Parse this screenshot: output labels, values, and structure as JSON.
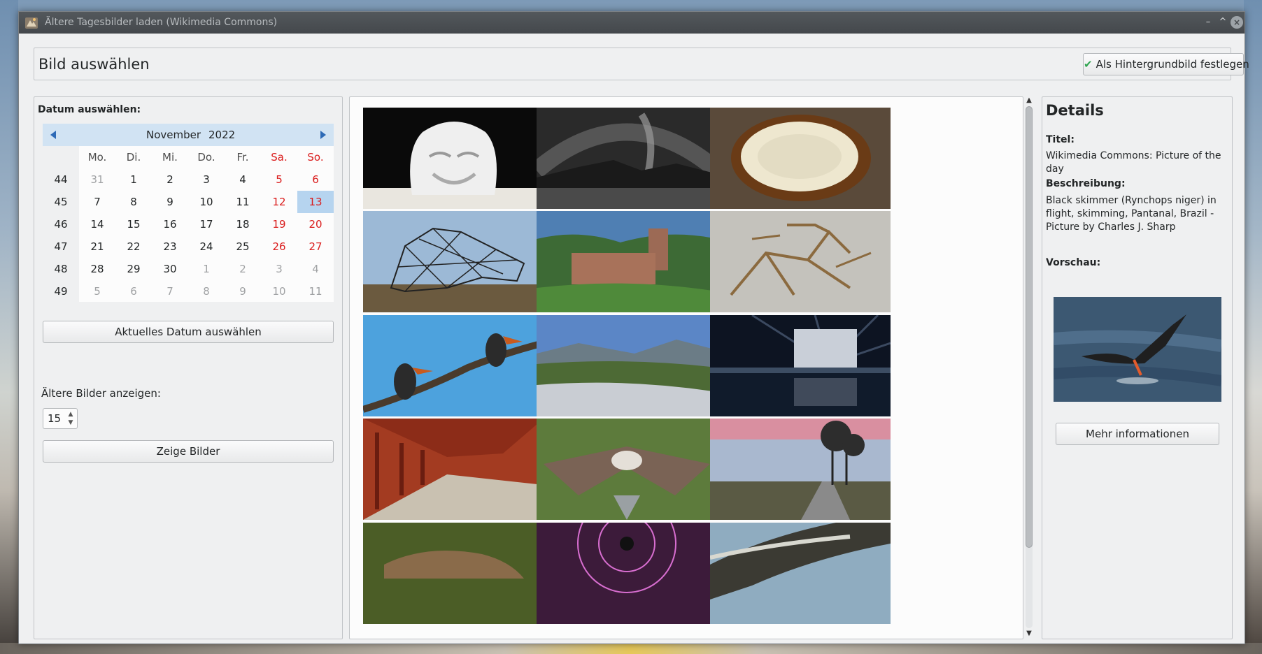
{
  "window": {
    "title": "Ältere Tagesbilder laden (Wikimedia Commons)",
    "minimize_glyph": "–",
    "maximize_glyph": "^",
    "close_glyph": "×"
  },
  "header": {
    "title": "Bild auswählen",
    "set_wallpaper_label": "Als Hintergrundbild festlegen",
    "check_glyph": "✔"
  },
  "date_panel": {
    "label": "Datum auswählen:",
    "calendar": {
      "month": "November",
      "year": "2022",
      "weekdays": [
        "Mo.",
        "Di.",
        "Mi.",
        "Do.",
        "Fr.",
        "Sa.",
        "So."
      ],
      "weeks": [
        {
          "week": "44",
          "days": [
            "31",
            "1",
            "2",
            "3",
            "4",
            "5",
            "6"
          ]
        },
        {
          "week": "45",
          "days": [
            "7",
            "8",
            "9",
            "10",
            "11",
            "12",
            "13"
          ]
        },
        {
          "week": "46",
          "days": [
            "14",
            "15",
            "16",
            "17",
            "18",
            "19",
            "20"
          ]
        },
        {
          "week": "47",
          "days": [
            "21",
            "22",
            "23",
            "24",
            "25",
            "26",
            "27"
          ]
        },
        {
          "week": "48",
          "days": [
            "28",
            "29",
            "30",
            "1",
            "2",
            "3",
            "4"
          ]
        },
        {
          "week": "49",
          "days": [
            "5",
            "6",
            "7",
            "8",
            "9",
            "10",
            "11"
          ]
        }
      ],
      "selected_day": "13"
    },
    "current_date_label": "Aktuelles Datum auswählen",
    "older_images_label": "Ältere Bilder anzeigen:",
    "older_images_count": "15",
    "show_images_label": "Zeige Bilder"
  },
  "gallery": {
    "thumbnails": [
      "sculpture-head",
      "milky-way-panorama",
      "cut-mushroom",
      "wire-sculpture",
      "castle-ruins",
      "fossil-slab",
      "hornbills",
      "valley-forest",
      "illuminated-building",
      "red-corridor",
      "moth",
      "tree-road-sunset",
      "reptile",
      "spider-web",
      "river-aerial"
    ]
  },
  "details": {
    "heading": "Details",
    "title_label": "Titel:",
    "title_value": "Wikimedia Commons: Picture of the day",
    "description_label": "Beschreibung:",
    "description_value": "Black skimmer (Rynchops niger) in flight, skimming, Pantanal, Brazil - Picture by Charles J. Sharp",
    "preview_label": "Vorschau:",
    "more_info_label": "Mehr informationen"
  },
  "colors": {
    "accent": "#b6d4ef",
    "weekend": "#da1c1c",
    "check": "#2ea44f"
  }
}
